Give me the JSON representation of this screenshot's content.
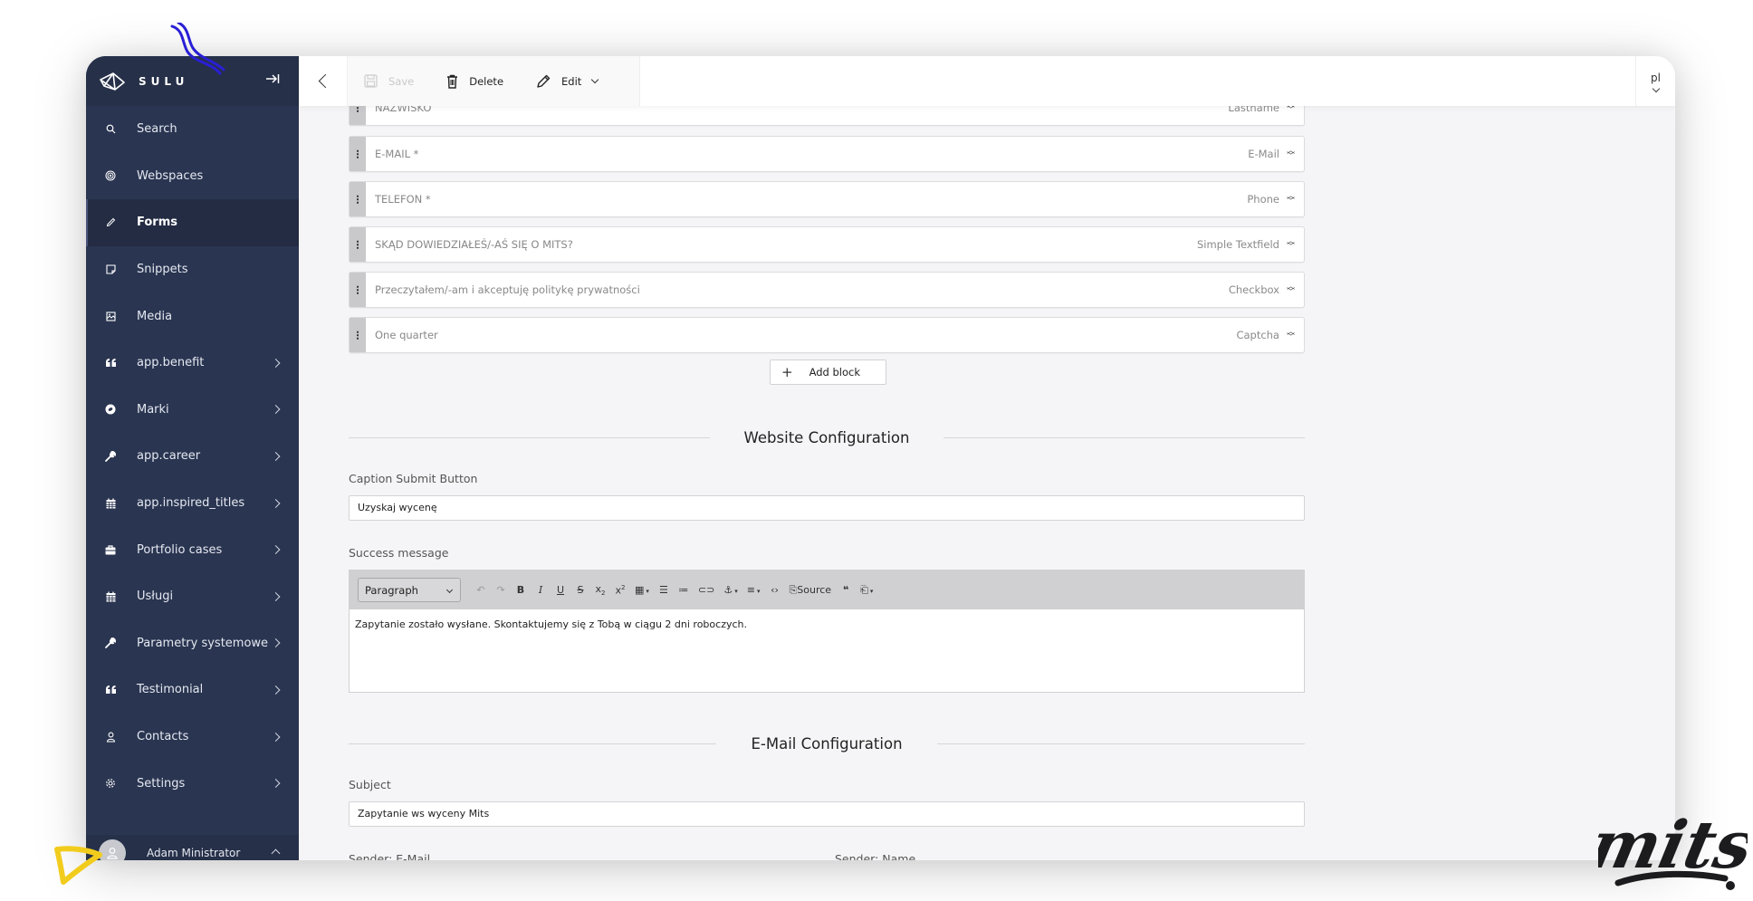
{
  "app": {
    "logo_text": "SULU",
    "brand_watermark": "mits"
  },
  "sidebar": {
    "items": [
      {
        "label": "Search",
        "icon": "search-icon",
        "active": false,
        "expandable": false
      },
      {
        "label": "Webspaces",
        "icon": "target-icon",
        "active": false,
        "expandable": false
      },
      {
        "label": "Forms",
        "icon": "pencil-icon",
        "active": true,
        "expandable": false
      },
      {
        "label": "Snippets",
        "icon": "sticky-note-icon",
        "active": false,
        "expandable": false
      },
      {
        "label": "Media",
        "icon": "image-icon",
        "active": false,
        "expandable": false
      },
      {
        "label": "app.benefit",
        "icon": "quote-icon",
        "active": false,
        "expandable": true
      },
      {
        "label": "Marki",
        "icon": "badge-icon",
        "active": false,
        "expandable": true
      },
      {
        "label": "app.career",
        "icon": "wrench-icon",
        "active": false,
        "expandable": true
      },
      {
        "label": "app.inspired_titles",
        "icon": "calendar-icon",
        "active": false,
        "expandable": true
      },
      {
        "label": "Portfolio cases",
        "icon": "briefcase-icon",
        "active": false,
        "expandable": true
      },
      {
        "label": "Usługi",
        "icon": "calendar-icon",
        "active": false,
        "expandable": true
      },
      {
        "label": "Parametry systemowe",
        "icon": "wrench-icon",
        "active": false,
        "expandable": true
      },
      {
        "label": "Testimonial",
        "icon": "quote-icon",
        "active": false,
        "expandable": true
      },
      {
        "label": "Contacts",
        "icon": "user-icon",
        "active": false,
        "expandable": true
      },
      {
        "label": "Settings",
        "icon": "gear-icon",
        "active": false,
        "expandable": true
      }
    ],
    "user": {
      "name": "Adam Ministrator"
    }
  },
  "toolbar": {
    "save_label": "Save",
    "save_disabled": true,
    "delete_label": "Delete",
    "edit_label": "Edit",
    "locale": "pl"
  },
  "form": {
    "blocks": [
      {
        "title": "NAZWISKO",
        "type": "Lastname"
      },
      {
        "title": "E-MAIL *",
        "type": "E-Mail"
      },
      {
        "title": "TELEFON *",
        "type": "Phone"
      },
      {
        "title": "SKĄD DOWIEDZIAŁEŚ/-AŚ SIĘ O MITS?",
        "type": "Simple Textfield"
      },
      {
        "title": "Przeczytałem/-am i akceptuję politykę prywatności",
        "type": "Checkbox"
      },
      {
        "title": "One quarter",
        "type": "Captcha"
      }
    ],
    "add_block_label": "Add block",
    "website_config": {
      "title": "Website Configuration",
      "caption_label": "Caption Submit Button",
      "caption_value": "Uzyskaj wycenę",
      "success_label": "Success message",
      "editor": {
        "format": "Paragraph",
        "source_label": "Source",
        "content": "Zapytanie zostało wysłane. Skontaktujemy się z Tobą w ciągu 2 dni roboczych."
      }
    },
    "email_config": {
      "title": "E-Mail Configuration",
      "subject_label": "Subject",
      "subject_value": "Zapytanie ws wyceny Mits",
      "sender_email_label": "Sender: E-Mail",
      "sender_name_label": "Sender: Name"
    }
  }
}
